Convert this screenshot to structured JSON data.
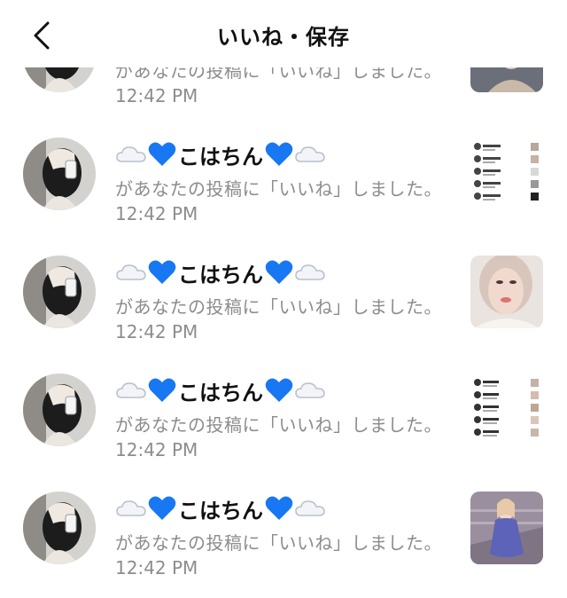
{
  "header": {
    "title": "いいね・保存",
    "back_icon": "chevron-left-icon"
  },
  "notifications": [
    {
      "message": "があなたの投稿に「いいね」しました。",
      "time": "12:42 PM",
      "thumb_kind": "photo-portrait"
    },
    {
      "username": "こはちん",
      "message": "があなたの投稿に「いいね」しました。",
      "time": "12:42 PM",
      "thumb_kind": "screenshot-list"
    },
    {
      "username": "こはちん",
      "message": "があなたの投稿に「いいね」しました。",
      "time": "12:42 PM",
      "thumb_kind": "photo-face"
    },
    {
      "username": "こはちん",
      "message": "があなたの投稿に「いいね」しました。",
      "time": "12:42 PM",
      "thumb_kind": "screenshot-list"
    },
    {
      "username": "こはちん",
      "message": "があなたの投稿に「いいね」しました。",
      "time": "12:42 PM",
      "thumb_kind": "photo-stairs"
    }
  ],
  "decorations": {
    "name_prefix_icons": [
      "cloud-icon",
      "blue-heart-icon"
    ],
    "name_suffix_icons": [
      "blue-heart-icon",
      "cloud-icon"
    ]
  },
  "colors": {
    "heart": "#1877f2",
    "secondary_text": "#8c8c8c",
    "primary_text": "#111111"
  }
}
